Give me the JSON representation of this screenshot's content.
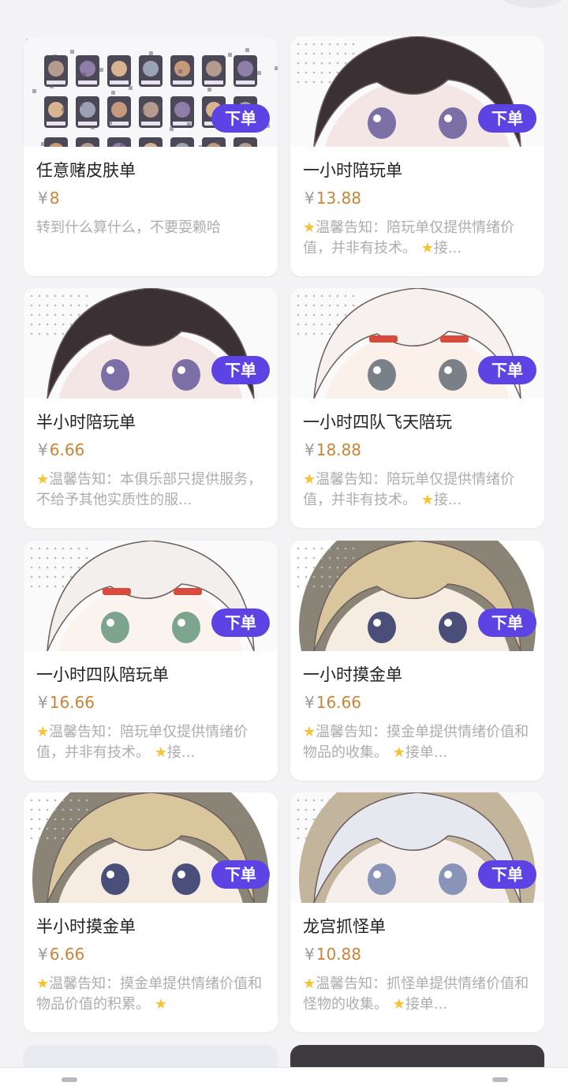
{
  "cards": [
    {
      "title": "任意赌皮肤单",
      "currency": "¥",
      "price": "8",
      "desc": "转到什么算什么，不要耍赖哈",
      "star1": false,
      "star2": false,
      "order_label": "下单",
      "art": "grid"
    },
    {
      "title": "一小时陪玩单",
      "currency": "¥",
      "price": "13.88",
      "desc": "温馨告知：陪玩单仅提供情绪价值，并非有技术。",
      "desc_tail": "接...",
      "star1": true,
      "star2": true,
      "order_label": "下单",
      "art": "dark-hair"
    },
    {
      "title": "半小时陪玩单",
      "currency": "¥",
      "price": "6.66",
      "desc": "温馨告知：本俱乐部只提供服务，不给予其他实质性的服...",
      "star1": true,
      "star2": false,
      "order_label": "下单",
      "art": "dark-hair"
    },
    {
      "title": "一小时四队飞天陪玩",
      "currency": "¥",
      "price": "18.88",
      "desc": "温馨告知：陪玩单仅提供情绪价值，并非有技术。",
      "desc_tail": "接...",
      "star1": true,
      "star2": true,
      "order_label": "下单",
      "art": "white-hair-red"
    },
    {
      "title": "一小时四队陪玩单",
      "currency": "¥",
      "price": "16.66",
      "desc": "温馨告知：陪玩单仅提供情绪价值，并非有技术。",
      "desc_tail": "接...",
      "star1": true,
      "star2": true,
      "order_label": "下单",
      "art": "white-hair-green"
    },
    {
      "title": "一小时摸金单",
      "currency": "¥",
      "price": "16.66",
      "desc": "温馨告知：摸金单提供情绪价值和物品的收集。",
      "desc_tail": "接单...",
      "star1": true,
      "star2": true,
      "order_label": "下单",
      "art": "blonde"
    },
    {
      "title": "半小时摸金单",
      "currency": "¥",
      "price": "6.66",
      "desc": "温馨告知：摸金单提供情绪价值和物品价值的积累。",
      "desc_tail": "",
      "star1": true,
      "star2": true,
      "order_label": "下单",
      "art": "blonde"
    },
    {
      "title": "龙宫抓怪单",
      "currency": "¥",
      "price": "10.88",
      "desc": "温馨告知：抓怪单提供情绪价值和怪物的收集。",
      "desc_tail": "接单...",
      "star1": true,
      "star2": true,
      "order_label": "下单",
      "art": "silver-hair"
    }
  ],
  "colors": {
    "order_button": "#5d43e3",
    "price": "#c98438",
    "desc": "#adadad",
    "star": "#f7c234"
  }
}
